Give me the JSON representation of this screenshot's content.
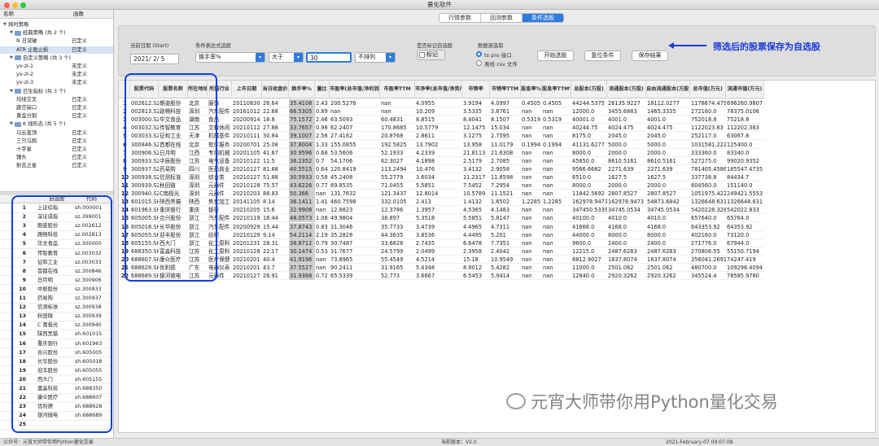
{
  "window": {
    "title": "量化软件"
  },
  "tree": {
    "headers": [
      "名称",
      "函数"
    ],
    "nodes": [
      {
        "label": "择时策略",
        "level": 0,
        "def": "",
        "arrow": "▼"
      },
      {
        "label": "经典策略 (共 2 个)",
        "level": 1,
        "def": "",
        "arrow": "▼",
        "folder": true
      },
      {
        "label": "N 日突破",
        "level": 2,
        "def": "已定义"
      },
      {
        "label": "ATR 止盈止损",
        "level": 2,
        "def": "已定义",
        "selected": true
      },
      {
        "label": "自定义策略 (共 3 个)",
        "level": 1,
        "def": "",
        "arrow": "▼",
        "folder": true
      },
      {
        "label": "yx-zl-1",
        "level": 2,
        "def": "未定义"
      },
      {
        "label": "yx-zl-2",
        "level": 2,
        "def": "未定义"
      },
      {
        "label": "yx-zl-3",
        "level": 2,
        "def": "未定义"
      },
      {
        "label": "日生指标 (共 3 个)",
        "level": 1,
        "def": "",
        "arrow": "▼",
        "folder": true
      },
      {
        "label": "均线交叉",
        "level": 2,
        "def": "已定义"
      },
      {
        "label": "跳空缺口",
        "level": 2,
        "def": "已定义"
      },
      {
        "label": "黄金分割",
        "level": 2,
        "def": "已定义"
      },
      {
        "label": "K 线形态 (共 5 个)",
        "level": 1,
        "def": "",
        "arrow": "▼",
        "folder": true
      },
      {
        "label": "乌云盖顶",
        "level": 2,
        "def": "已定义"
      },
      {
        "label": "三只乌鸦",
        "level": 2,
        "def": "已定义"
      },
      {
        "label": "十字星",
        "level": 2,
        "def": "已定义"
      },
      {
        "label": "锤头",
        "level": 2,
        "def": "已定义"
      },
      {
        "label": "射击之星",
        "level": 2,
        "def": "已定义"
      }
    ]
  },
  "stock_list": {
    "headers": [
      "自选股",
      "代码"
    ],
    "rows": [
      [
        "1",
        "上证综指",
        "sh.000001"
      ],
      [
        "2",
        "深证成指",
        "sz.399001"
      ],
      [
        "3",
        "朗姿股份",
        "sz.002612"
      ],
      [
        "4",
        "路畅科技",
        "sz.002813"
      ],
      [
        "5",
        "华文食品",
        "sz.300000"
      ],
      [
        "6",
        "传智教育",
        "sz.003032"
      ],
      [
        "7",
        "征和工业",
        "sz.003033"
      ],
      [
        "8",
        "首都在线",
        "sz.300846"
      ],
      [
        "9",
        "日月明",
        "sz.300906"
      ],
      [
        "10",
        "中辰股份",
        "sz.300933"
      ],
      [
        "11",
        "药易购",
        "sz.300937"
      ],
      [
        "12",
        "信测标准",
        "sz.300938"
      ],
      [
        "13",
        "秋田微",
        "sz.300939"
      ],
      [
        "14",
        "C 南极光",
        "sz.300940"
      ],
      [
        "15",
        "陕西黑猫",
        "sh.601015"
      ],
      [
        "16",
        "重庆银行",
        "sh.601963"
      ],
      [
        "17",
        "合兴股份",
        "sh.605005"
      ],
      [
        "18",
        "长华股份",
        "sh.605018"
      ],
      [
        "19",
        "迎丰股份",
        "sh.605055"
      ],
      [
        "20",
        "西大门",
        "sh.605155"
      ],
      [
        "21",
        "富淼科技",
        "sh.688350"
      ],
      [
        "22",
        "康众医疗",
        "sh.688607"
      ],
      [
        "23",
        "优利德",
        "sh.688628"
      ],
      [
        "24",
        "银河微电",
        "sh.688689"
      ],
      [
        "25",
        "",
        ""
      ]
    ]
  },
  "tabs": [
    {
      "label": "行情参数",
      "active": false
    },
    {
      "label": "回测参数",
      "active": false
    },
    {
      "label": "条件选股",
      "active": true
    }
  ],
  "controls": {
    "date_label": "当前日期 (Start)",
    "date_value": "2021/  2/  5",
    "expr_label": "条件表达式选股",
    "field_value": "换手率%",
    "op_value": "大于",
    "threshold_value": "30",
    "sort_value": "不排列",
    "mark_group_label": "是否标记自选股",
    "mark_label": "标记",
    "source_label": "数据源选取",
    "source_opt1": "ts pro 接口",
    "source_opt2": "离线 csv 文件",
    "btn_start": "开始选股",
    "btn_reset": "复位条件",
    "btn_save": "保存结果"
  },
  "annotation_note": "筛选后的股票保存为自选股",
  "watermark": "元宵大师带你用Python量化交易",
  "table": {
    "headers": [
      "",
      "股票代码",
      "股票名称",
      "所在地域",
      "所属行业",
      "上市日期",
      "当日收盘价",
      "换手率%",
      "量比",
      "市盈率(总市值/净利润)",
      "市盈率TTM",
      "市净率(总市值/净资产)",
      "市销率",
      "市销率TTM",
      "股息率%",
      "股息率TTM%",
      "总股本(万股)",
      "流通股本(万股)",
      "自由流通股本(万股)",
      "总市值(万元)",
      "流通市值(万元)"
    ],
    "rows": [
      [
        "1",
        "002612.SZ",
        "朗姿股份",
        "北京",
        "服饰",
        "20110830",
        "26.64",
        "35.4108",
        "2.43",
        "200.5276",
        "nan",
        "4.0955",
        "3.9194",
        "4.0997",
        "0.4505",
        "0.4505",
        "44244.5375",
        "26135.9227",
        "18112.0277",
        "1178674.479",
        "696260.9807"
      ],
      [
        "2",
        "002813.SZ",
        "路畅科技",
        "深圳",
        "汽车配件",
        "20161012",
        "22.68",
        "66.5305",
        "0.89",
        "nan",
        "nan",
        "10.209",
        "3.5335",
        "3.8761",
        "nan",
        "nan",
        "12000.0",
        "3455.6883",
        "1465.3335",
        "272160.0",
        "78375.0106"
      ],
      [
        "3",
        "003000.SZ",
        "华文食品",
        "湖南",
        "食品",
        "20200914",
        "18.8",
        "75.1572",
        "2.46",
        "63.5093",
        "60.4831",
        "8.8515",
        "8.4041",
        "8.1507",
        "0.5319",
        "0.5319",
        "40001.0",
        "4001.0",
        "4001.0",
        "752018.8",
        "75218.8"
      ],
      [
        "4",
        "003032.SZ",
        "传智教育",
        "江苏",
        "文教休闲",
        "20210112",
        "27.88",
        "33.7657",
        "0.98",
        "62.2407",
        "170.8685",
        "10.5779",
        "12.1475",
        "15.034",
        "nan",
        "nan",
        "40244.75",
        "4024.475",
        "4024.475",
        "1122023.63",
        "112202.363"
      ],
      [
        "5",
        "003033.SZ",
        "征和工业",
        "天津",
        "机械基件",
        "20210111",
        "30.84",
        "39.1007",
        "2.56",
        "27.4162",
        "20.8768",
        "2.8611",
        "3.1275",
        "2.7595",
        "nan",
        "nan",
        "8175.0",
        "2045.0",
        "2045.0",
        "252117.0",
        "63067.8"
      ],
      [
        "6",
        "300846.SZ",
        "首都在线",
        "北京",
        "软件服务",
        "20200701",
        "25.08",
        "37.8004",
        "1.33",
        "155.0855",
        "192.5825",
        "13.7902",
        "13.958",
        "11.0179",
        "0.1994",
        "0.1994",
        "41131.6277",
        "5000.0",
        "5000.0",
        "1031581.2227",
        "125400.0"
      ],
      [
        "7",
        "300906.SZ",
        "日月明",
        "江西",
        "专用机械",
        "20201105",
        "41.67",
        "30.9596",
        "0.68",
        "53.5606",
        "52.1933",
        "4.2339",
        "21.8113",
        "21.6308",
        "nan",
        "nan",
        "8000.0",
        "2000.0",
        "2000.0",
        "333360.0",
        "83340.0"
      ],
      [
        "8",
        "300933.SZ",
        "中辰股份",
        "江苏",
        "电气设备",
        "20210122",
        "11.5",
        "36.2352",
        "0.7",
        "54.1706",
        "62.3027",
        "4.1898",
        "2.5179",
        "2.7085",
        "nan",
        "nan",
        "45850.0",
        "8610.5161",
        "8610.5161",
        "527275.0",
        "99020.9352"
      ],
      [
        "9",
        "300937.SZ",
        "药易购",
        "四川",
        "医药商业",
        "20210127",
        "81.68",
        "40.5515",
        "0.64",
        "120.8419",
        "113.2494",
        "10.476",
        "3.4132",
        "2.9058",
        "nan",
        "nan",
        "9566.6682",
        "2271.639",
        "2271.639",
        "781405.4586",
        "185547.4735"
      ],
      [
        "10",
        "300938.SZ",
        "信测标准",
        "深圳",
        "综合类",
        "20210127",
        "51.88",
        "30.5933",
        "0.58",
        "45.2408",
        "55.2779",
        "3.6034",
        "11.2317",
        "11.8598",
        "nan",
        "nan",
        "6510.0",
        "1627.5",
        "1627.5",
        "337738.8",
        "84434.7"
      ],
      [
        "11",
        "300939.SZ",
        "秋田微",
        "深圳",
        "元器件",
        "20210128",
        "75.57",
        "43.6226",
        "0.77",
        "69.8535",
        "71.0455",
        "5.5851",
        "7.5452",
        "7.2954",
        "nan",
        "nan",
        "8000.0",
        "2000.0",
        "2000.0",
        "604560.0",
        "151140.0"
      ],
      [
        "12",
        "300940.SZ",
        "C南极光",
        "深圳",
        "元器件",
        "20210203",
        "88.83",
        "50.366",
        "nan",
        "131.7632",
        "121.3437",
        "12.8014",
        "10.5789",
        "11.1521",
        "nan",
        "nan",
        "11842.5692",
        "2807.8527",
        "2807.8527",
        "1051975.422",
        "249421.5553"
      ],
      [
        "13",
        "601015.SH",
        "陕西黑猫",
        "陕西",
        "焦炭加工",
        "20141105",
        "8.14",
        "36.1411",
        "1.41",
        "460.7598",
        "332.0105",
        "2.413",
        "1.4132",
        "1.6502",
        "1.2285",
        "1.2285",
        "162978.9473",
        "162978.9473",
        "54873.6842",
        "1326648.631",
        "1326648.631"
      ],
      [
        "14",
        "601963.SH",
        "重庆银行",
        "重庆",
        "银行",
        "20210205",
        "15.6",
        "32.9908",
        "nan",
        "12.8823",
        "12.3786",
        "1.3957",
        "4.5365",
        "4.1483",
        "nan",
        "nan",
        "347450.5339",
        "34745.0534",
        "34745.0534",
        "5420228.3288",
        "542022.833"
      ],
      [
        "15",
        "605005.SH",
        "合兴股份",
        "浙江",
        "汽车配件",
        "20210119",
        "16.44",
        "48.0573",
        "1.08",
        "49.9804",
        "38.897",
        "5.3518",
        "5.5851",
        "5.8147",
        "nan",
        "nan",
        "40100.0",
        "4010.0",
        "4010.0",
        "657640.0",
        "65764.0"
      ],
      [
        "16",
        "605018.SH",
        "长华股份",
        "浙江",
        "汽车配件",
        "20200929",
        "15.44",
        "37.8743",
        "0.83",
        "31.3046",
        "35.7733",
        "3.4739",
        "4.4965",
        "4.7311",
        "nan",
        "nan",
        "41668.0",
        "4168.0",
        "4168.0",
        "643353.92",
        "64353.92"
      ],
      [
        "17",
        "605055.SH",
        "迎丰股份",
        "浙江",
        "纺织",
        "20210129",
        "9.14",
        "54.2114",
        "2.19",
        "35.2828",
        "44.3635",
        "3.8536",
        "4.4495",
        "5.201",
        "nan",
        "nan",
        "44000.0",
        "8000.0",
        "8000.0",
        "402160.0",
        "73120.0"
      ],
      [
        "18",
        "605155.SH",
        "西大门",
        "浙江",
        "化工原料",
        "20201231",
        "28.31",
        "38.8712",
        "0.79",
        "30.7487",
        "33.6828",
        "2.7435",
        "6.6478",
        "7.7351",
        "nan",
        "nan",
        "9600.0",
        "2400.0",
        "2400.0",
        "271776.0",
        "67944.0"
      ],
      [
        "19",
        "688350.SH",
        "富淼科技",
        "江苏",
        "化工原料",
        "20210128",
        "22.17",
        "30.1474",
        "0.53",
        "31.7677",
        "24.5799",
        "2.0499",
        "2.3958",
        "2.4042",
        "nan",
        "nan",
        "12215.0",
        "2487.6283",
        "2487.6283",
        "270806.55",
        "55150.7194"
      ],
      [
        "20",
        "688607.SH",
        "康众医疗",
        "江苏",
        "医疗保健",
        "20210201",
        "40.4",
        "41.9196",
        "nan",
        "73.8965",
        "55.4549",
        "4.5214",
        "15.18",
        "10.9549",
        "nan",
        "nan",
        "8812.9027",
        "1837.8074",
        "1837.8074",
        "356041.2691",
        "74247.419"
      ],
      [
        "21",
        "688628.SH",
        "优利德",
        "广东",
        "电器仪表",
        "20210201",
        "43.7",
        "37.5527",
        "nan",
        "90.2411",
        "31.9165",
        "5.4348",
        "8.9012",
        "5.4282",
        "nan",
        "nan",
        "11000.0",
        "2501.062",
        "2501.062",
        "480700.0",
        "109296.4094"
      ],
      [
        "22",
        "688689.SH",
        "银河微电",
        "江苏",
        "元器件",
        "20210127",
        "26.91",
        "31.9368",
        "0.72",
        "65.5339",
        "52.773",
        "3.6667",
        "6.5453",
        "5.9414",
        "nan",
        "nan",
        "12840.0",
        "2920.3262",
        "2920.3262",
        "345524.4",
        "78585.9780"
      ]
    ]
  },
  "status": {
    "left": "公众号：元宵大师带你用Python量化交易",
    "center": "当前版本：V2.0",
    "right": "2021-February-07 09:07:08"
  },
  "colors": {
    "accent": "#2f7be0",
    "annotation": "#1a3ad8",
    "highlight_col": "#cfcfcf"
  }
}
